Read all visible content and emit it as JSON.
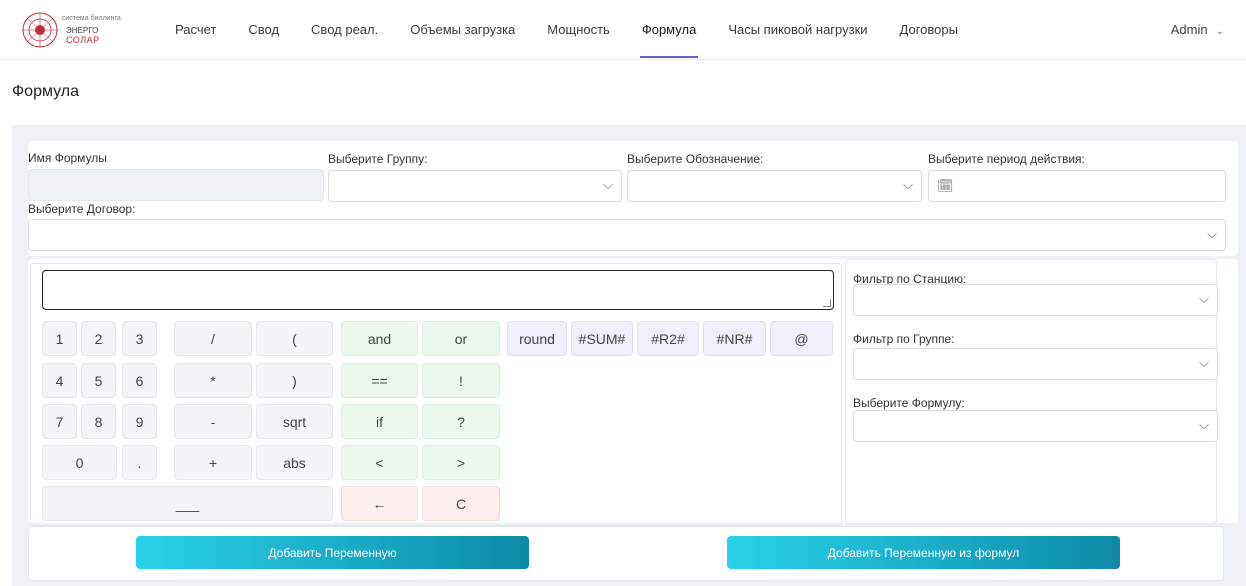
{
  "brand": {
    "line1": "система биллинга",
    "line2": "ЭНЕРГО",
    "line3": "СОЛАР"
  },
  "nav": [
    "Расчет",
    "Свод",
    "Свод реал.",
    "Объемы загрузка",
    "Мощность",
    "Формула",
    "Часы пиковой нагрузки",
    "Договоры"
  ],
  "user": "Admin",
  "page_title": "Формула",
  "form": {
    "formula_name_label": "Имя Формулы",
    "group_label": "Выберите Группу:",
    "designation_label": "Выберите Обозначение:",
    "period_label": "Выберите период действия:",
    "contract_label": "Выберите Договор:"
  },
  "keypad": {
    "numbers": [
      "1",
      "2",
      "3",
      "4",
      "5",
      "6",
      "7",
      "8",
      "9",
      "0",
      "."
    ],
    "ops": [
      "/",
      "(",
      "*",
      ")",
      "-",
      "sqrt",
      "+",
      "abs"
    ],
    "logic": [
      "and",
      "or",
      "==",
      "!",
      "if",
      "?",
      "<",
      ">"
    ],
    "special": [
      "round",
      "#SUM#",
      "#R2#",
      "#NR#",
      "@"
    ],
    "space": "___",
    "backspace": "←",
    "clear": "C"
  },
  "filters": {
    "station_label": "Фильтр по Станцию:",
    "group_label": "Фильтр по Группе:",
    "formula_label": "Выберите Формулу:"
  },
  "buttons": {
    "add_variable": "Добавить Переменную",
    "add_from_formula": "Добавить Переменную из формул"
  }
}
